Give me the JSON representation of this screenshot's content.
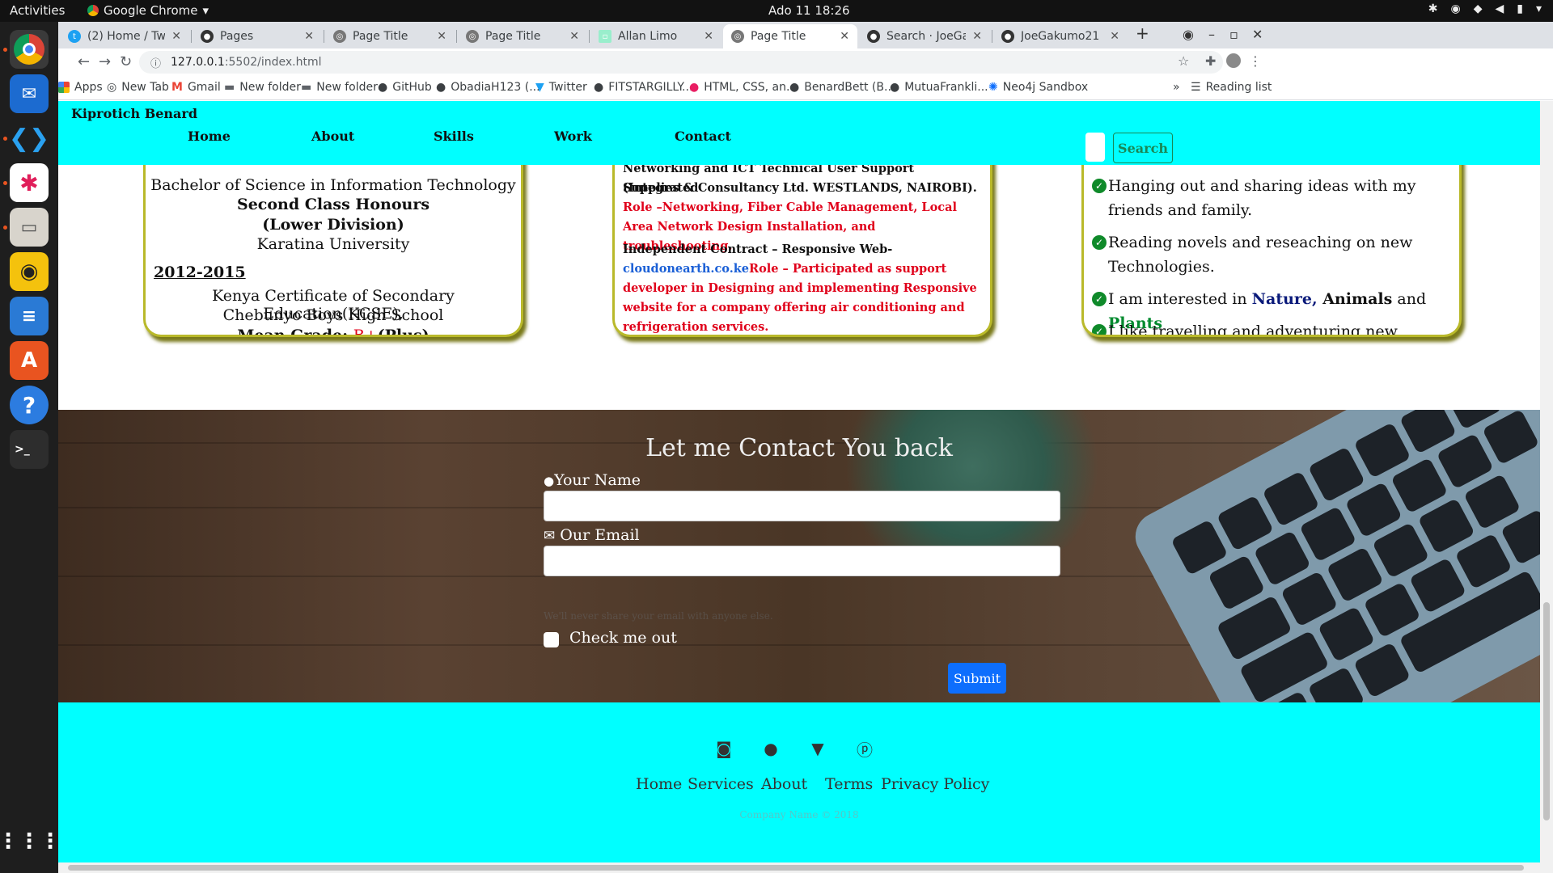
{
  "topbar": {
    "activities": "Activities",
    "app": "Google Chrome",
    "clock": "Ado 11  18:26"
  },
  "tabs": [
    {
      "title": "(2) Home / Twitter"
    },
    {
      "title": "Pages"
    },
    {
      "title": "Page Title"
    },
    {
      "title": "Page Title"
    },
    {
      "title": "Allan Limo"
    },
    {
      "title": "Page Title"
    },
    {
      "title": "Search · JoeGakumo"
    },
    {
      "title": "JoeGakumo21"
    }
  ],
  "omnibox": {
    "host": "127.0.0.1",
    "path": ":5502/index.html"
  },
  "bookmarks": [
    "Apps",
    "New Tab",
    "Gmail",
    "New folder",
    "New folder",
    "GitHub",
    "ObadiaH123 (...",
    "Twitter",
    "FITSTARGILLY...",
    "HTML, CSS, an...",
    "BenardBett (B...",
    "MutuaFrankli...",
    "Neo4j Sandbox",
    "Reading list"
  ],
  "site": {
    "brand": "Kiprotich Benard",
    "nav": [
      "Home",
      "About",
      "Skills",
      "Work",
      "Contact"
    ],
    "search_btn": "Search"
  },
  "education": {
    "degree": "Bachelor of Science in Information Technology",
    "honours": "Second Class Honours",
    "division": "(Lower Division)",
    "university": "Karatina University",
    "year": "2012-2015",
    "kcse": "Kenya Certificate of Secondary Education(KCSE),",
    "school": "Chebunyo Boys High School",
    "grade_label": "Mean Grade: ",
    "grade": "B+",
    "grade_suffix": "(Plus)"
  },
  "work": {
    "line1": "Networking and ICT Technical User Support (Integrated",
    "line2": "Supplies & Consultancy Ltd. WESTLANDS, NAIROBI).",
    "role1": "Role –Networking, Fiber Cable Management, Local Area Network Design Installation, and troubleshooting.",
    "contract": "Independent Contract – Responsive Web-",
    "link": "cloudonearth.co.ke",
    "role2": "Role – Participated as support developer in Designing and implementing Responsive website for a company offering air conditioning and refrigeration services."
  },
  "hobbies": {
    "h1": "Hanging out and sharing ideas with my friends and family.",
    "h2": "Reading novels and reseaching on new Technologies.",
    "h3_pre": "I am interested in ",
    "h3_nature": "Nature,",
    "h3_animals": " Animals",
    "h3_and": " and ",
    "h3_plants": "Plants",
    "h4": "I like travelling and adventuring new places, meeting new friends and sharing life experiences"
  },
  "contact": {
    "title": "Let me Contact You back",
    "name_label": "Your Name",
    "email_label": "Our Email",
    "help": "We'll never share your email with anyone else.",
    "check_label": "Check me out",
    "submit": "Submit"
  },
  "footer": {
    "links": [
      "Home",
      "Services",
      "About",
      "Terms",
      "Privacy Policy"
    ],
    "copyright": "Company Name © 2018"
  },
  "colors": {
    "nav_bg": "#00ffff",
    "red": "#e0001a",
    "green": "#008a2e",
    "navy": "#0a1a7a",
    "link_blue": "#0d6efd"
  }
}
